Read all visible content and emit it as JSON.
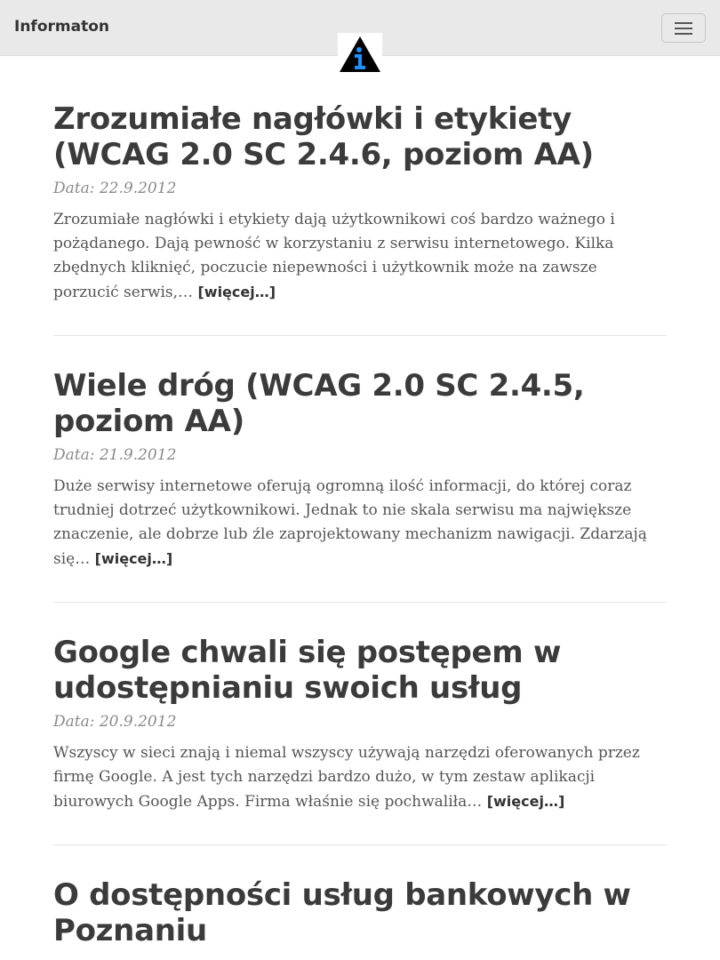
{
  "nav": {
    "brand": "Informaton",
    "toggle_icon": "hamburger-icon",
    "logo_icon": "info-triangle-logo-icon"
  },
  "posts": [
    {
      "title": "Zrozumiałe nagłówki i etykiety (WCAG 2.0 SC 2.4.6, poziom AA)",
      "meta": "Data: 22.9.2012",
      "excerpt": "Zrozumiałe nagłówki i etykiety dają użytkownikowi coś bardzo ważnego i pożądanego. Dają pewność w korzystaniu z serwisu internetowego. Kilka zbędnych kliknięć, poczucie niepewności i użytkownik może na zawsze porzucić serwis,…",
      "more": "[więcej…]"
    },
    {
      "title": "Wiele dróg (WCAG 2.0 SC 2.4.5, poziom AA)",
      "meta": "Data: 21.9.2012",
      "excerpt": "Duże serwisy internetowe oferują ogromną ilość informacji, do której coraz trudniej dotrzeć użytkownikowi. Jednak to nie skala serwisu ma największe znaczenie, ale dobrze lub źle zaprojektowany mechanizm nawigacji. Zdarzają się…",
      "more": "[więcej…]"
    },
    {
      "title": "Google chwali się postępem w udostępnianiu swoich usług",
      "meta": "Data: 20.9.2012",
      "excerpt": "Wszyscy w sieci znają i niemal wszyscy używają narzędzi oferowanych przez firmę Google. A jest tych narzędzi bardzo dużo, w tym zestaw aplikacji biurowych Google Apps. Firma właśnie się pochwaliła…",
      "more": "[więcej…]"
    },
    {
      "title": "O dostępności usług bankowych w Poznaniu"
    }
  ],
  "colors": {
    "navbar_bg": "#e9e9e9",
    "logo_triangle": "#000000",
    "logo_i": "#1e90ff"
  }
}
